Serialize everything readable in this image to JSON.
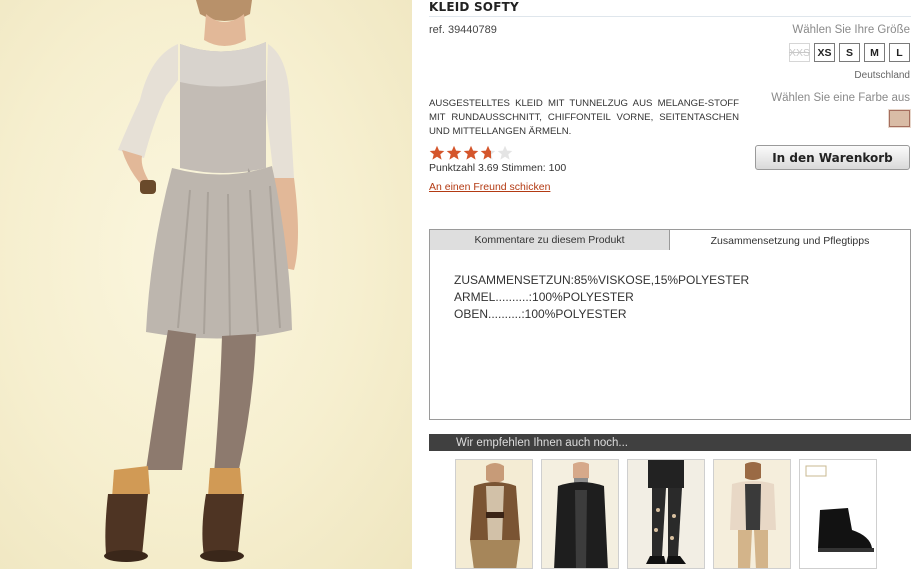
{
  "product": {
    "title": "KLEID SOFTY",
    "ref": "ref. 39440789",
    "description": "AUSGESTELLTES KLEID MIT TUNNELZUG AUS MELANGE-STOFF MIT RUNDAUSSCHNITT, CHIFFONTEIL VORNE, SEITENTASCHEN UND MITTELLANGEN ÄRMELN.",
    "photo_icon": "dress-model-photo"
  },
  "size_selector": {
    "label": "Wählen Sie Ihre Größe",
    "sizes": [
      "XXS",
      "XS",
      "S",
      "M",
      "L"
    ],
    "unavailable": [
      "XXS"
    ],
    "country": "Deutschland"
  },
  "color_selector": {
    "label": "Wählen Sie eine Farbe aus",
    "swatch_color": "#d9bca6"
  },
  "rating": {
    "value": 3.69,
    "max": 5,
    "score_text": "Punktzahl 3.69 Stimmen: 100",
    "star_color": "#d4552b",
    "empty_star_color": "#e4e4e4"
  },
  "links": {
    "friend": "An einen Freund schicken"
  },
  "cart": {
    "button_label": "In den Warenkorb"
  },
  "tabs": {
    "items": [
      {
        "label": "Kommentare zu diesem Produkt"
      },
      {
        "label": "Zusammensetzung und Pflegtipps"
      }
    ],
    "active": 1,
    "composition": [
      "ZUSAMMENSETZUN:85%VISKOSE,15%POLYESTER",
      "ARMEL..........:100%POLYESTER",
      "OBEN..........:100%POLYESTER"
    ]
  },
  "recommendations": {
    "header": "Wir empfehlen Ihnen auch noch...",
    "items": [
      {
        "icon": "fur-vest-photo"
      },
      {
        "icon": "black-cardigan-photo"
      },
      {
        "icon": "lace-tights-photo"
      },
      {
        "icon": "beige-cardigan-photo"
      },
      {
        "icon": "ankle-boot-photo"
      }
    ]
  },
  "colors": {
    "accent_link": "#b33a13",
    "rec_bar": "#404040"
  }
}
